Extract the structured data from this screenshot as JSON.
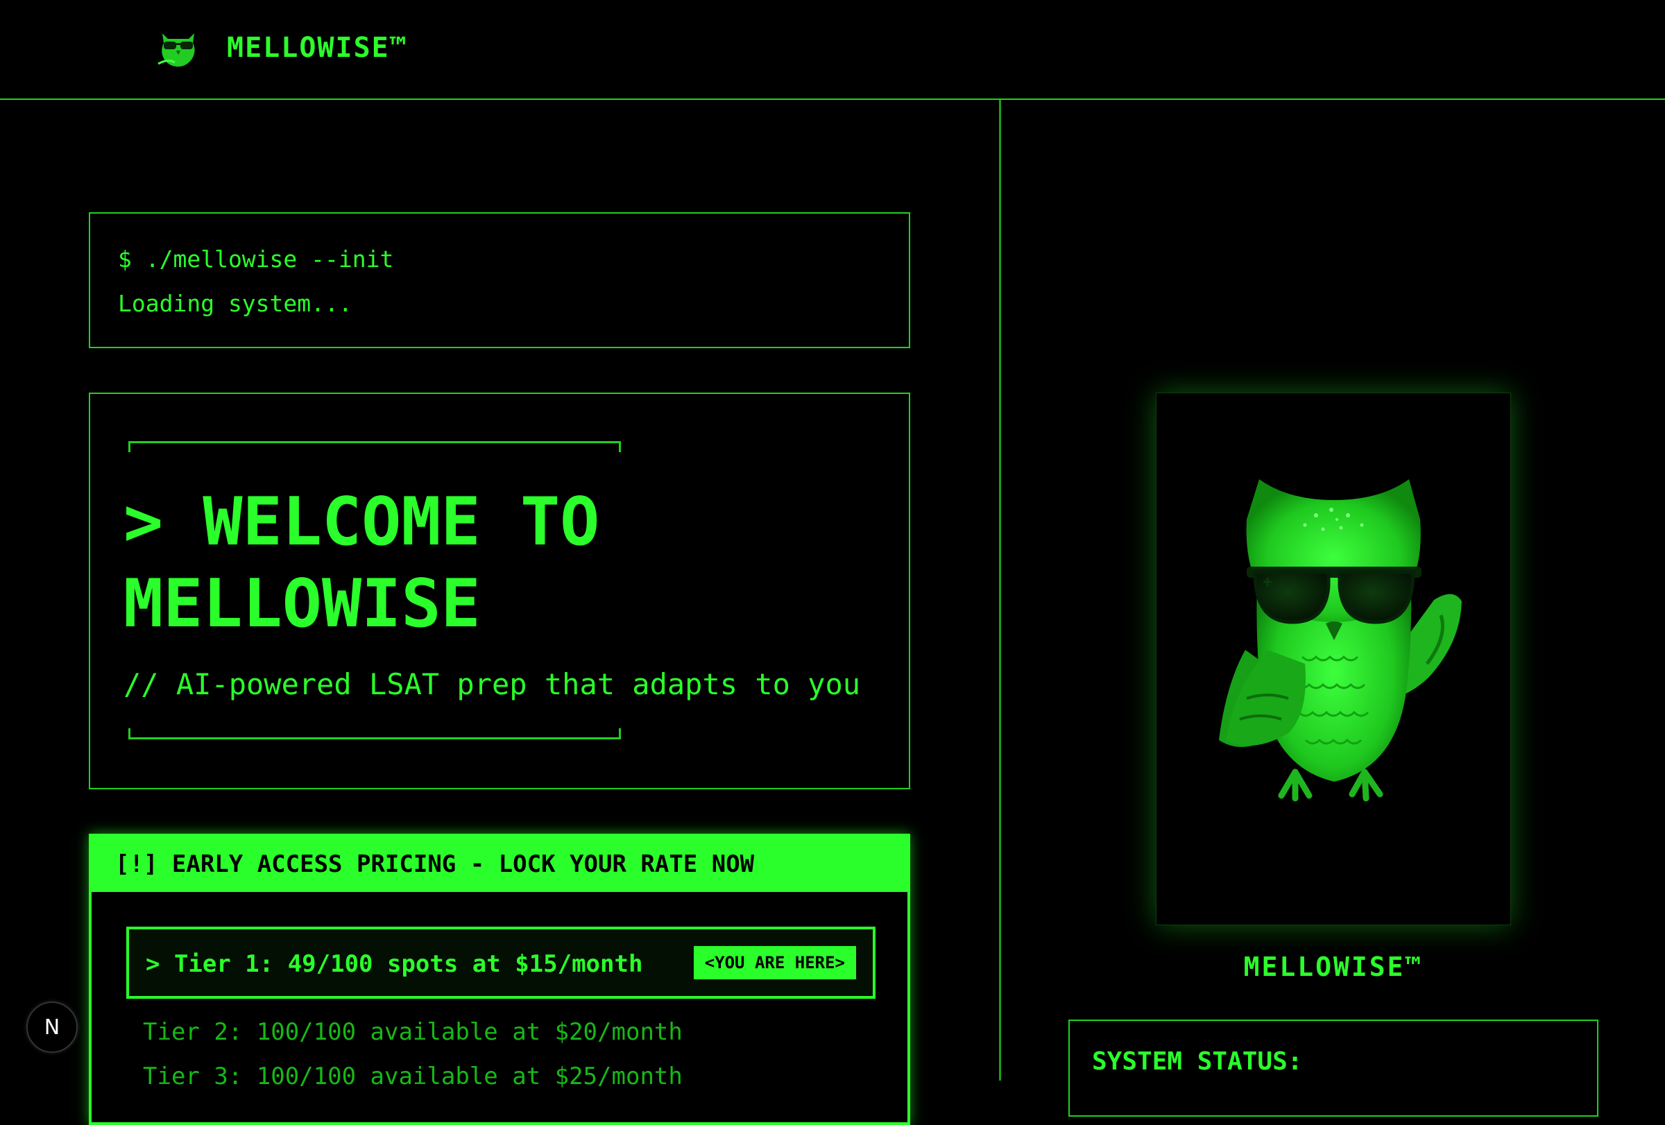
{
  "header": {
    "logo_icon": "owl-logo-icon",
    "brand": "MELLOWISE™"
  },
  "terminal": {
    "command": "$ ./mellowise --init",
    "status": "Loading system..."
  },
  "welcome": {
    "title": "> WELCOME TO MELLOWISE",
    "subtitle": "// AI-powered LSAT prep that adapts to you"
  },
  "pricing": {
    "banner": "[!] EARLY ACCESS PRICING - LOCK YOUR RATE NOW",
    "active_tier": {
      "label": "> Tier 1: 49/100 spots at $15/month",
      "badge": "<YOU ARE HERE>"
    },
    "tiers": [
      "Tier 2: 100/100 available at $20/month",
      "Tier 3: 100/100 available at $25/month"
    ]
  },
  "floating_badge": {
    "label": "N"
  },
  "mascot": {
    "image": "owl-with-sunglasses-illustration",
    "caption": "MELLOWISE™"
  },
  "system_status": {
    "title": "SYSTEM STATUS:"
  },
  "colors": {
    "background": "#000000",
    "accent": "#2bff2b",
    "dim_accent": "#17b817"
  }
}
